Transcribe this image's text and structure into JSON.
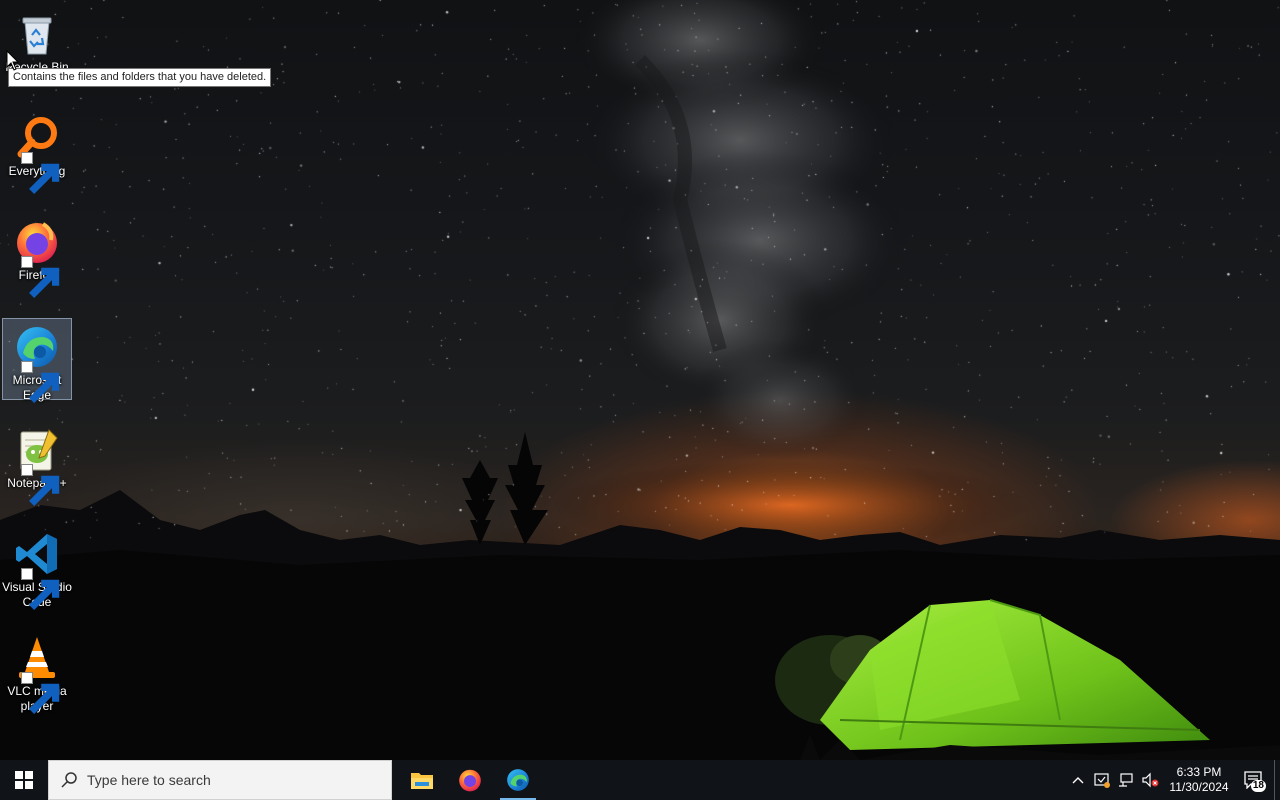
{
  "desktop": {
    "icons": [
      {
        "label": "Recycle Bin",
        "icon": "recycle-bin-icon"
      },
      {
        "label": "Everything",
        "icon": "everything-search-icon"
      },
      {
        "label": "Firefox",
        "icon": "firefox-icon"
      },
      {
        "label": "Microsoft Edge",
        "icon": "edge-icon"
      },
      {
        "label": "Notepad++",
        "icon": "notepadpp-icon"
      },
      {
        "label": "Visual Studio Code",
        "icon": "vscode-icon"
      },
      {
        "label": "VLC media player",
        "icon": "vlc-icon"
      }
    ],
    "tooltip": "Contains the files and folders that you have deleted.",
    "selected_icon": "Microsoft Edge"
  },
  "taskbar": {
    "search_placeholder": "Type here to search",
    "pinned_apps": [
      {
        "name": "File Explorer",
        "icon": "file-explorer-icon"
      },
      {
        "name": "Firefox",
        "icon": "firefox-icon"
      },
      {
        "name": "Microsoft Edge",
        "icon": "edge-icon",
        "active": true
      }
    ],
    "clock": {
      "time": "6:33 PM",
      "date": "11/30/2024"
    },
    "notification_count": "18"
  },
  "colors": {
    "taskbar_bg": "#101318",
    "accent": "#76b9ed",
    "tent_green": "#7ed321"
  }
}
